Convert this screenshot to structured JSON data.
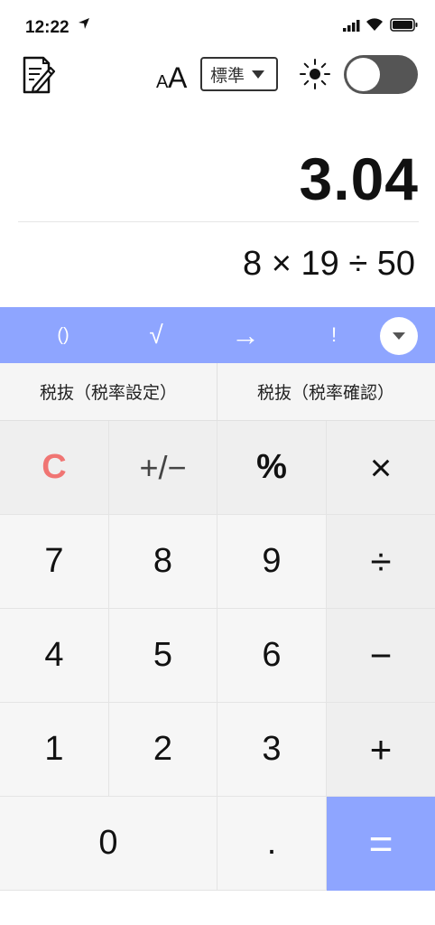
{
  "status_bar": {
    "time": "12:22"
  },
  "toolbar": {
    "font_size_label": "AA",
    "mode_value": "標準",
    "theme_toggle_on": true
  },
  "display": {
    "result": "3.04",
    "expression": "8 × 19 ÷ 50"
  },
  "function_bar": {
    "parens": "()",
    "sqrt": "√",
    "arrow": "→",
    "factorial": "!"
  },
  "tax": {
    "exclude_label": "税抜（税率設定）",
    "confirm_label": "税抜（税率確認）"
  },
  "keys": {
    "clear": "C",
    "sign": "+/−",
    "percent": "%",
    "multiply": "×",
    "seven": "7",
    "eight": "8",
    "nine": "9",
    "divide": "÷",
    "four": "4",
    "five": "5",
    "six": "6",
    "minus": "−",
    "one": "1",
    "two": "2",
    "three": "3",
    "plus": "+",
    "zero": "0",
    "dot": ".",
    "equals": "="
  },
  "colors": {
    "accent": "#8ea5ff",
    "clear": "#f07573",
    "toggle": "#555555"
  }
}
